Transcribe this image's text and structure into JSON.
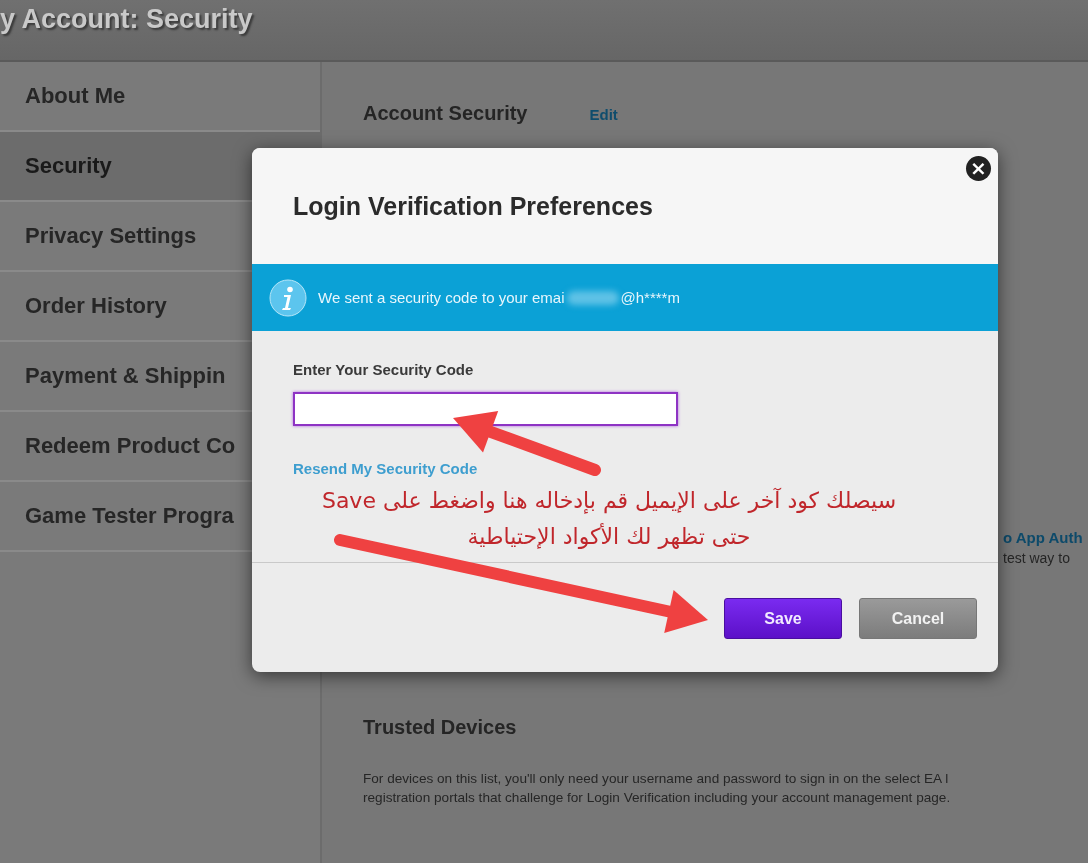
{
  "header": {
    "title": "y Account: Security"
  },
  "sidebar": {
    "items": [
      {
        "label": "About Me",
        "selected": false
      },
      {
        "label": "Security",
        "selected": true
      },
      {
        "label": "Privacy Settings",
        "selected": false
      },
      {
        "label": "Order History",
        "selected": false
      },
      {
        "label": "Payment & Shippin",
        "selected": false
      },
      {
        "label": "Redeem Product Co",
        "selected": false
      },
      {
        "label": "Game Tester Progra",
        "selected": false
      }
    ]
  },
  "main": {
    "account_security": {
      "heading": "Account Security",
      "link": "Edit"
    },
    "app_auth": {
      "link": "o App Auth",
      "text": "test way to"
    },
    "trusted_devices": {
      "heading": "Trusted Devices",
      "lines": [
        "For devices on this list, you'll only need your username and password to sign in on the select EA l",
        "registration portals that challenge for Login Verification including your account management page."
      ]
    }
  },
  "dialog": {
    "title": "Login Verification Preferences",
    "close": "×",
    "info": {
      "text": "We sent a security code to your emai",
      "masked": "@h****m"
    },
    "field": {
      "label": "Enter Your Security Code",
      "focused": true
    },
    "resend_link": "Resend My Security Code",
    "buttons": [
      {
        "label": "Save",
        "kind": "primary"
      },
      {
        "label": "Cancel",
        "kind": "secondary"
      }
    ]
  },
  "annotation": {
    "lines": [
      "سيصلك كود آخر على الإيميل قم بإدخاله هنا واضغط على Save",
      "حتى تظهر لك الأكواد الإحتياطية"
    ]
  }
}
